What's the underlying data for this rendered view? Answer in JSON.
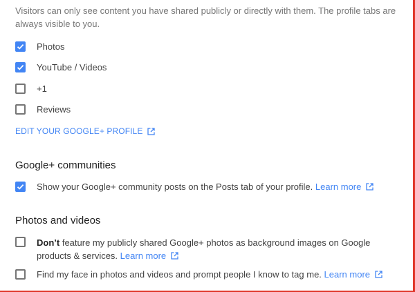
{
  "intro": {
    "text": "Visitors can only see content you have shared publicly or directly with them. The profile tabs are always visible to you."
  },
  "tabs": {
    "items": [
      {
        "label": "Photos",
        "checked": true
      },
      {
        "label": "YouTube / Videos",
        "checked": true
      },
      {
        "label": "+1",
        "checked": false
      },
      {
        "label": "Reviews",
        "checked": false
      }
    ]
  },
  "edit_profile_link": {
    "label": "EDIT YOUR GOOGLE+ PROFILE",
    "icon": "external-link-icon"
  },
  "communities": {
    "heading": "Google+ communities",
    "option": {
      "label": "Show your Google+ community posts on the Posts tab of your profile.",
      "checked": true,
      "link": "Learn more"
    }
  },
  "photos_videos": {
    "heading": "Photos and videos",
    "option1": {
      "bold": "Don’t",
      "label": " feature my publicly shared Google+ photos as background images on Google products & services.",
      "checked": false,
      "link": "Learn more"
    },
    "option2": {
      "label": "Find my face in photos and videos and prompt people I know to tag me.",
      "checked": false,
      "link": "Learn more"
    }
  },
  "colors": {
    "accent": "#4285f4",
    "frame": "#e0372a",
    "muted_text": "#757575"
  }
}
